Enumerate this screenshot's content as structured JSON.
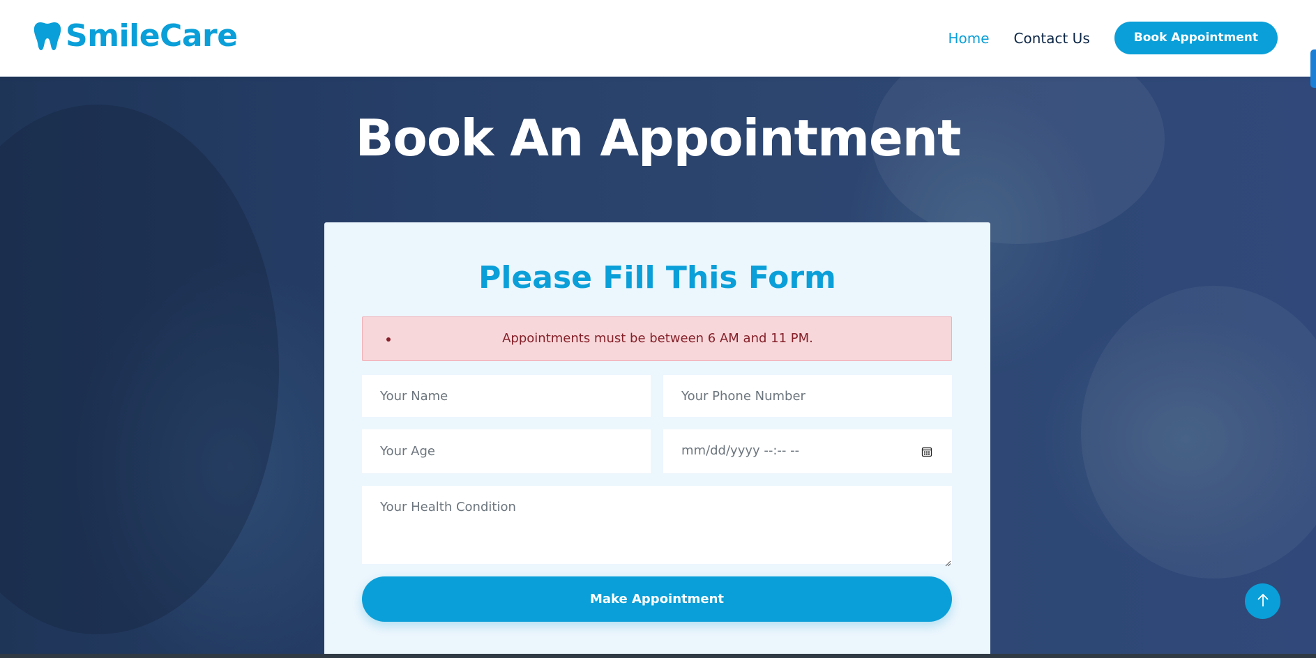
{
  "header": {
    "brand_name": "SmileCare",
    "brand_icon": "tooth-icon",
    "nav": [
      {
        "label": "Home",
        "active": true
      },
      {
        "label": "Contact Us",
        "active": false
      }
    ],
    "cta_label": "Book Appointment"
  },
  "hero": {
    "title": "Book An Appointment"
  },
  "form": {
    "title": "Please Fill This Form",
    "alert_message": "Appointments must be between 6 AM and 11 PM.",
    "name_placeholder": "Your Name",
    "phone_placeholder": "Your Phone Number",
    "age_placeholder": "Your Age",
    "datetime_placeholder": "mm/dd/yyyy --:-- --",
    "datetime_icon": "calendar-icon",
    "health_placeholder": "Your Health Condition",
    "submit_label": "Make Appointment"
  },
  "scroll_top_icon": "arrow-up-icon",
  "colors": {
    "accent": "#0a9fd8",
    "nav_text": "#0b2545",
    "hero_overlay": "#233a5e",
    "card_bg": "#ecf6fd",
    "alert_bg": "#f8d7da",
    "alert_text": "#842029"
  }
}
